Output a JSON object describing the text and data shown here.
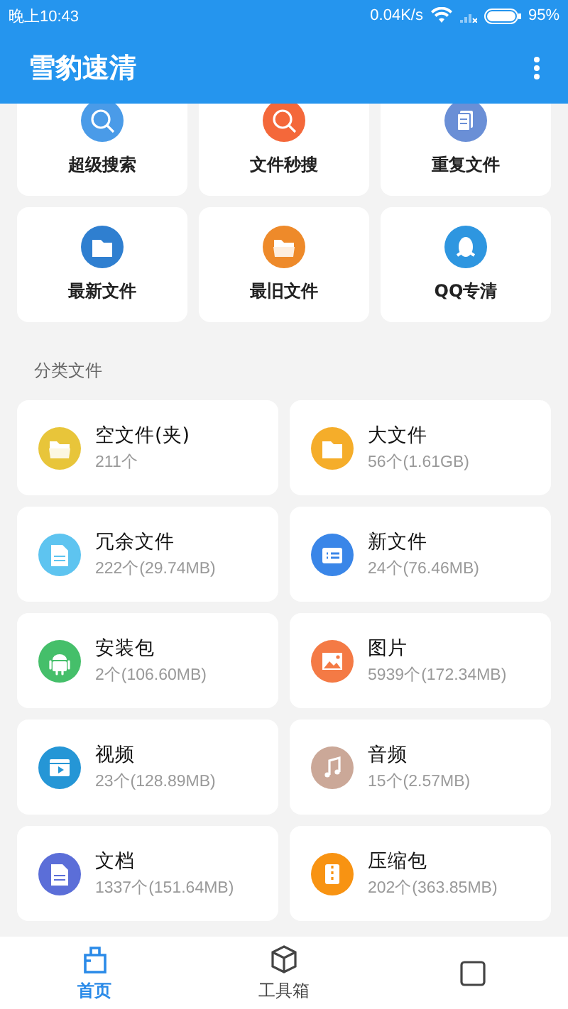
{
  "status_bar": {
    "time": "晚上10:43",
    "speed": "0.04K/s",
    "battery": "95%"
  },
  "app_bar": {
    "title": "雪豹速清"
  },
  "tools": [
    {
      "label": "超级搜索",
      "kind": "search",
      "color": "#4a9be8"
    },
    {
      "label": "文件秒搜",
      "kind": "search",
      "color": "#f4683a"
    },
    {
      "label": "重复文件",
      "kind": "copy",
      "color": "#6a8fd6"
    },
    {
      "label": "最新文件",
      "kind": "folder",
      "color": "#2f7fd0"
    },
    {
      "label": "最旧文件",
      "kind": "folder-open",
      "color": "#ee8a2a"
    },
    {
      "label": "QQ专清",
      "kind": "penguin",
      "color": "#2e96e0"
    }
  ],
  "section_title": "分类文件",
  "categories": [
    {
      "name": "空文件(夹)",
      "info": "211个",
      "kind": "folder-open",
      "color": "#e8c53a"
    },
    {
      "name": "大文件",
      "info": "56个(1.61GB)",
      "kind": "folder",
      "color": "#f5ad2a"
    },
    {
      "name": "冗余文件",
      "info": "222个(29.74MB)",
      "kind": "doc",
      "color": "#5ec4f0"
    },
    {
      "name": "新文件",
      "info": "24个(76.46MB)",
      "kind": "list",
      "color": "#3a86e8"
    },
    {
      "name": "安装包",
      "info": "2个(106.60MB)",
      "kind": "android",
      "color": "#45bf6a"
    },
    {
      "name": "图片",
      "info": "5939个(172.34MB)",
      "kind": "image",
      "color": "#f47a45"
    },
    {
      "name": "视频",
      "info": "23个(128.89MB)",
      "kind": "video",
      "color": "#2596d6"
    },
    {
      "name": "音频",
      "info": "15个(2.57MB)",
      "kind": "music",
      "color": "#cba898"
    },
    {
      "name": "文档",
      "info": "1337个(151.64MB)",
      "kind": "doc",
      "color": "#5b6ed8"
    },
    {
      "name": "压缩包",
      "info": "202个(363.85MB)",
      "kind": "zip",
      "color": "#f89312"
    }
  ],
  "bottom_nav": [
    {
      "label": "首页",
      "kind": "home",
      "selected": true
    },
    {
      "label": "工具箱",
      "kind": "box",
      "selected": false
    }
  ]
}
